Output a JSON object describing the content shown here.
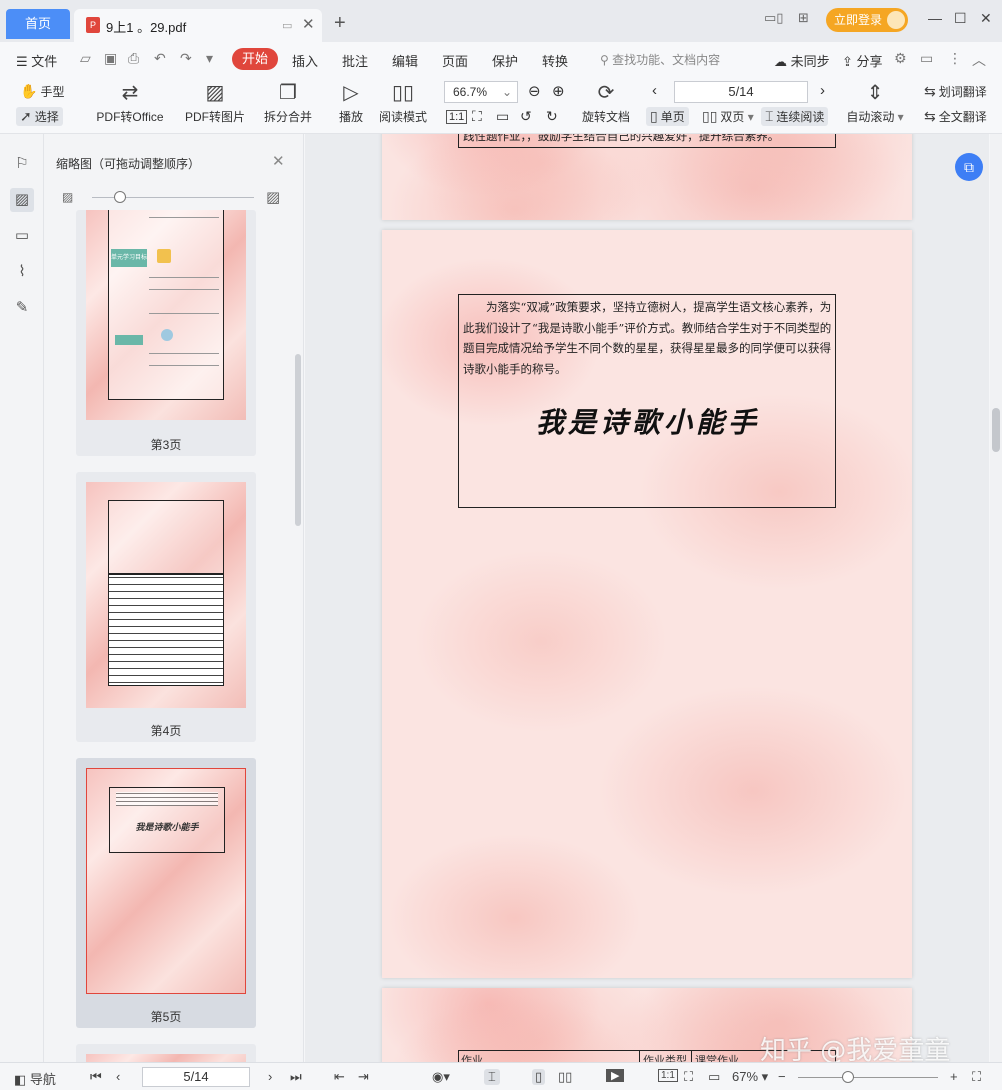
{
  "titlebar": {
    "home_tab": "首页",
    "doc_tab": "9上1 。29.pdf",
    "login": "立即登录"
  },
  "menu": {
    "file": "文件",
    "start": "开始",
    "items": [
      "插入",
      "批注",
      "编辑",
      "页面",
      "保护",
      "转换"
    ],
    "search_placeholder": "查找功能、文档内容",
    "sync": "未同步",
    "share": "分享"
  },
  "toolbar": {
    "hand": "手型",
    "select": "选择",
    "pdf_to_office": "PDF转Office",
    "pdf_to_image": "PDF转图片",
    "split_merge": "拆分合并",
    "play": "播放",
    "read_mode": "阅读模式",
    "zoom": "66.7%",
    "rotate_doc": "旋转文档",
    "page_indicator": "5/14",
    "single": "单页",
    "double": "双页",
    "continuous": "连续阅读",
    "auto_scroll": "自动滚动",
    "word_translate": "划词翻译",
    "full_translate": "全文翻译"
  },
  "thumb_panel": {
    "title": "缩略图（可拖动调整顺序）",
    "pages": [
      {
        "label": "第3页",
        "selected": false
      },
      {
        "label": "第4页",
        "selected": false
      },
      {
        "label": "第5页",
        "selected": true
      }
    ],
    "p3_node": "单元学习目标",
    "p5_title": "我是诗歌小能手"
  },
  "document": {
    "prev_page_tail": "践性题作业，，鼓励学生结合自己的兴趣爱好，提升综合素养。",
    "body": "为落实“双减”政策要求，坚持立德树人，提高学生语文核心素养，为此我们设计了“我是诗歌小能手”评价方式。教师结合学生对于不同类型的题目完成情况给予学生不同个数的星星，获得星星最多的同学便可以获得诗歌小能手的称号。",
    "title": "我是诗歌小能手",
    "next_page_headers": [
      "作业",
      "作业类型",
      "课堂作业"
    ]
  },
  "watermark": "知乎 @我爱童童",
  "statusbar": {
    "nav": "导航",
    "page": "5/14",
    "zoom": "67%"
  }
}
